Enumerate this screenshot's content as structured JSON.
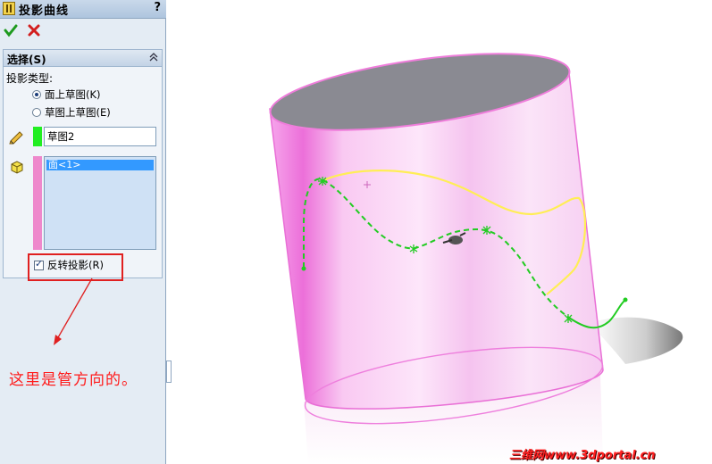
{
  "panel": {
    "title": "投影曲线",
    "help": "?",
    "selection": {
      "header": "选择(S)",
      "type_label": "投影类型:",
      "options": [
        {
          "label": "面上草图(K)",
          "selected": true
        },
        {
          "label": "草图上草图(E)",
          "selected": false
        }
      ],
      "sketch_value": "草图2",
      "faces": [
        "面<1>"
      ],
      "reverse_label": "反转投影(R)",
      "reverse_checked": true
    }
  },
  "annotation": {
    "note": "这里是管方向的。"
  },
  "watermark": "三维网www.3dportal.cn",
  "colors": {
    "panel_bg": "#e4ecf4",
    "surface_pink": "#f58fe8",
    "curve_yellow": "#ffee55",
    "curve_green": "#22cc22",
    "annotation_red": "#e02020"
  }
}
